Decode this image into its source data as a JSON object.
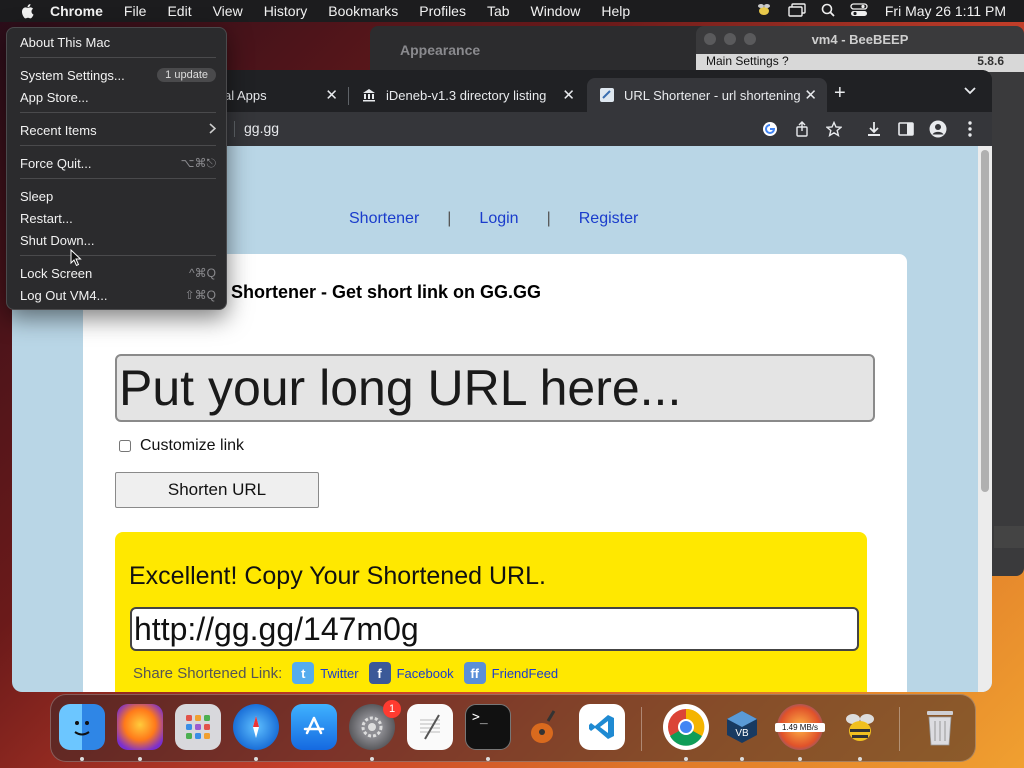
{
  "menubar": {
    "app_name": "Chrome",
    "items": [
      "File",
      "Edit",
      "View",
      "History",
      "Bookmarks",
      "Profiles",
      "Tab",
      "Window",
      "Help"
    ],
    "clock": "Fri May 26  1:11 PM"
  },
  "background_windows": {
    "appearance_title": "Appearance",
    "beebeep_title": "vm4 - BeeBEEP",
    "beebeep_menus": "Main   Settings   ?",
    "beebeep_version": "5.8.6"
  },
  "browser": {
    "tabs": [
      {
        "label": "al Apps"
      },
      {
        "label": "iDeneb-v1.3 directory listing"
      },
      {
        "label": "URL Shortener - url shortening",
        "active": true
      }
    ],
    "address": "gg.gg"
  },
  "page": {
    "nav": {
      "shortener": "Shortener",
      "login": "Login",
      "register": "Register",
      "separator": "|"
    },
    "title": "Shortener - Get short link on GG.GG",
    "url_input_placeholder": "Put your long URL here...",
    "customize_label": "Customize link",
    "shorten_button": "Shorten URL",
    "result": {
      "heading": "Excellent! Copy Your Shortened URL.",
      "short_url": "http://gg.gg/147m0g",
      "share_label": "Share Shortened Link:",
      "share_twitter": "Twitter",
      "share_facebook": "Facebook",
      "share_friendfeed": "FriendFeed"
    }
  },
  "apple_menu": {
    "about": "About This Mac",
    "system_settings": "System Settings...",
    "update_badge": "1 update",
    "app_store": "App Store...",
    "recent_items": "Recent Items",
    "force_quit": "Force Quit...",
    "force_quit_shortcut": "⌥⌘⎋",
    "sleep": "Sleep",
    "restart": "Restart...",
    "shut_down": "Shut Down...",
    "lock_screen": "Lock Screen",
    "lock_shortcut": "^⌘Q",
    "log_out": "Log Out VM4...",
    "log_out_shortcut": "⇧⌘Q"
  },
  "dock": {
    "items": [
      "finder",
      "firefox",
      "launchpad",
      "safari",
      "app-store",
      "system-settings",
      "textedit",
      "terminal",
      "garageband",
      "vscode",
      "chrome",
      "virtualbox",
      "network-monitor",
      "beebeep",
      "trash"
    ],
    "system_settings_badge": "1",
    "network_speed": "1.49 MB/s"
  },
  "colors": {
    "page_bg": "#b9d6e6",
    "result_bg": "#ffe800",
    "link": "#1a3ccc"
  }
}
